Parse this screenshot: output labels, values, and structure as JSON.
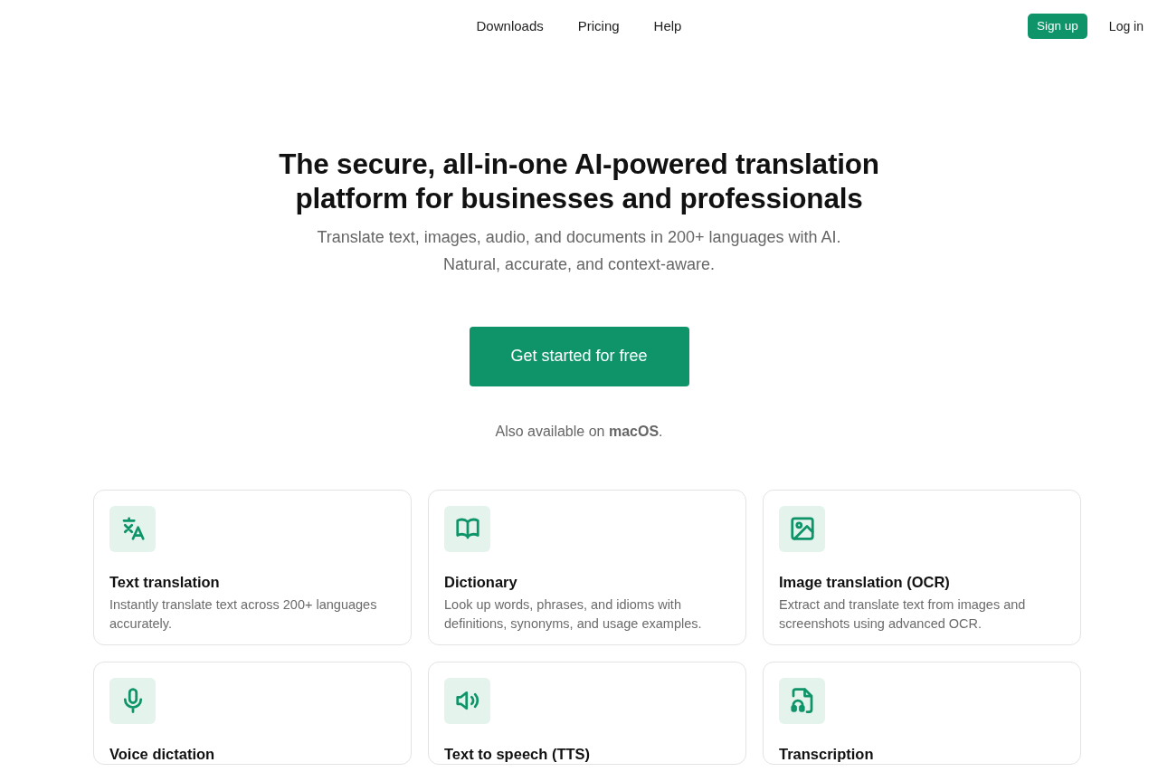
{
  "nav": {
    "links": [
      "Downloads",
      "Pricing",
      "Help"
    ],
    "signup": "Sign up",
    "login": "Log in"
  },
  "hero": {
    "title": "The secure, all-in-one AI-powered translation platform for businesses and professionals",
    "subtitle": [
      "Translate text, images, audio, and documents in 200+ languages with AI.",
      "Natural, accurate, and context-aware."
    ],
    "cta": "Get started for free",
    "also": "Also available on **macOS**."
  },
  "features": [
    {
      "title": "Text translation",
      "description": "Instantly translate text across 200+ languages accurately."
    },
    {
      "title": "Dictionary",
      "description": "Look up words, phrases, and idioms with definitions, synonyms, and usage examples."
    },
    {
      "title": "Image translation (OCR)",
      "description": "Extract and translate text from images and screenshots using advanced OCR."
    },
    {
      "title": "Voice dictation"
    },
    {
      "title": "Text to speech (TTS)"
    },
    {
      "title": "Transcription"
    }
  ]
}
